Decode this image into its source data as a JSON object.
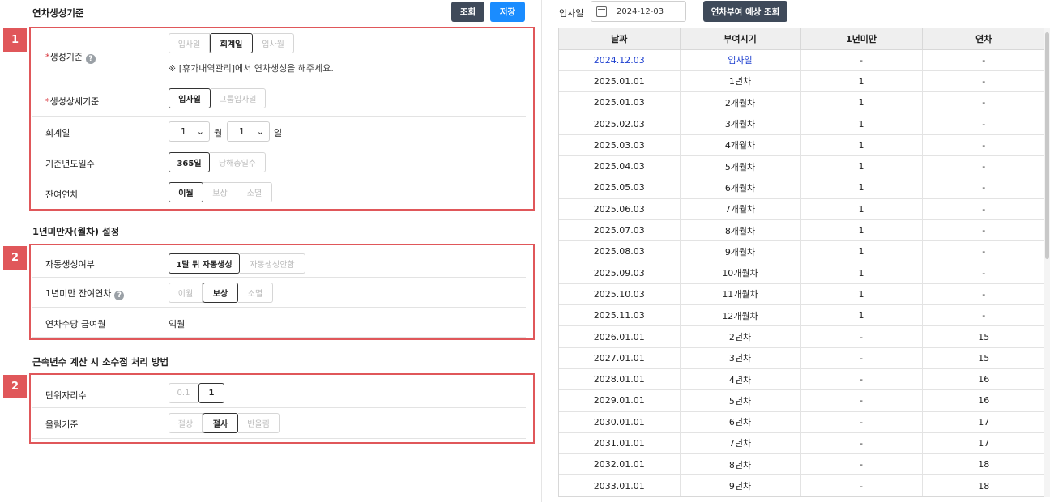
{
  "left": {
    "section1_title": "연차생성기준",
    "search_button": "조회",
    "save_button": "저장",
    "box1_badge": "1",
    "gen_basis": {
      "label": "생성기준",
      "options": [
        "입사일",
        "회계일",
        "입사월"
      ],
      "selected": "회계일",
      "note": "※ [휴가내역관리]에서 연차생성을 해주세요."
    },
    "gen_detail": {
      "label": "생성상세기준",
      "options": [
        "입사일",
        "그룹입사일"
      ],
      "selected": "입사일"
    },
    "fiscal_day": {
      "label": "회계일",
      "month": "1",
      "month_unit": "월",
      "day": "1",
      "day_unit": "일"
    },
    "base_days": {
      "label": "기준년도일수",
      "options": [
        "365일",
        "당해총일수"
      ],
      "selected": "365일"
    },
    "remaining": {
      "label": "잔여연차",
      "options": [
        "이월",
        "보상",
        "소멸"
      ],
      "selected": "이월"
    },
    "section2_title": "1년미만자(월차) 설정",
    "box2_badge": "2",
    "auto_gen": {
      "label": "자동생성여부",
      "options": [
        "1달 뒤 자동생성",
        "자동생성안함"
      ],
      "selected": "1달 뒤 자동생성"
    },
    "under_year_remaining": {
      "label": "1년미만 잔여연차",
      "options": [
        "이월",
        "보상",
        "소멸"
      ],
      "selected": "보상"
    },
    "allowance_month": {
      "label": "연차수당 급여월",
      "value": "익월"
    },
    "section3_title": "근속년수 계산 시 소수점 처리 방법",
    "box3_badge": "2",
    "decimal_unit": {
      "label": "단위자리수",
      "options": [
        "0.1",
        "1"
      ],
      "selected": "1"
    },
    "rounding": {
      "label": "올림기준",
      "options": [
        "절상",
        "절사",
        "반올림"
      ],
      "selected": "절사"
    }
  },
  "right": {
    "hire_date_label": "입사일",
    "hire_date_value": "2024-12-03",
    "predict_button": "연차부여 예상 조회",
    "columns": [
      "날짜",
      "부여시기",
      "1년미만",
      "연차"
    ],
    "rows": [
      [
        "2024.12.03",
        "입사일",
        "-",
        "-"
      ],
      [
        "2025.01.01",
        "1년차",
        "1",
        "-"
      ],
      [
        "2025.01.03",
        "2개월차",
        "1",
        "-"
      ],
      [
        "2025.02.03",
        "3개월차",
        "1",
        "-"
      ],
      [
        "2025.03.03",
        "4개월차",
        "1",
        "-"
      ],
      [
        "2025.04.03",
        "5개월차",
        "1",
        "-"
      ],
      [
        "2025.05.03",
        "6개월차",
        "1",
        "-"
      ],
      [
        "2025.06.03",
        "7개월차",
        "1",
        "-"
      ],
      [
        "2025.07.03",
        "8개월차",
        "1",
        "-"
      ],
      [
        "2025.08.03",
        "9개월차",
        "1",
        "-"
      ],
      [
        "2025.09.03",
        "10개월차",
        "1",
        "-"
      ],
      [
        "2025.10.03",
        "11개월차",
        "1",
        "-"
      ],
      [
        "2025.11.03",
        "12개월차",
        "1",
        "-"
      ],
      [
        "2026.01.01",
        "2년차",
        "-",
        "15"
      ],
      [
        "2027.01.01",
        "3년차",
        "-",
        "15"
      ],
      [
        "2028.01.01",
        "4년차",
        "-",
        "16"
      ],
      [
        "2029.01.01",
        "5년차",
        "-",
        "16"
      ],
      [
        "2030.01.01",
        "6년차",
        "-",
        "17"
      ],
      [
        "2031.01.01",
        "7년차",
        "-",
        "17"
      ],
      [
        "2032.01.01",
        "8년차",
        "-",
        "18"
      ],
      [
        "2033.01.01",
        "9년차",
        "-",
        "18"
      ]
    ],
    "highlight_color": "#1d3fcf"
  },
  "colors": {
    "accent_red": "#e0575a",
    "primary_blue": "#1a8cff",
    "dark_button": "#3f4a5a"
  }
}
